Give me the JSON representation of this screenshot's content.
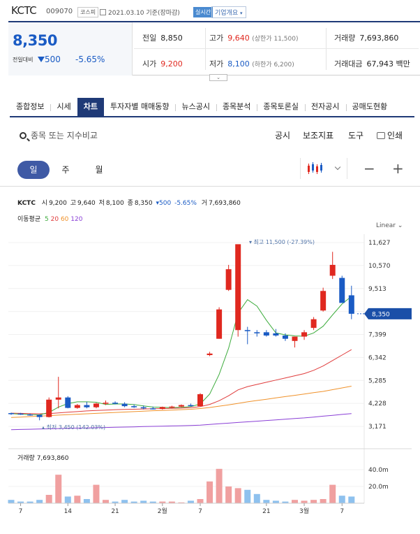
{
  "header": {
    "name": "KCTC",
    "code": "009070",
    "market": "코스피",
    "date": "2021.03.10 기준(장마감)",
    "realtime": "실시간",
    "corp_info": "기업개요"
  },
  "price": {
    "current": "8,350",
    "change_label": "전일대비",
    "change": "500",
    "pct": "-5.65%",
    "prev_label": "전일",
    "prev": "8,850",
    "high_label": "고가",
    "high": "9,640",
    "upper_limit": "(상한가 11,500)",
    "volume_label": "거래량",
    "volume": "7,693,860",
    "open_label": "시가",
    "open": "9,200",
    "low_label": "저가",
    "low": "8,100",
    "lower_limit": "(하한가 6,200)",
    "amount_label": "거래대금",
    "amount": "67,943",
    "amount_unit": "백만"
  },
  "tabs": [
    "종합정보",
    "시세",
    "차트",
    "투자자별 매매동향",
    "뉴스공시",
    "종목분석",
    "종목토론실",
    "전자공시",
    "공매도현황"
  ],
  "active_tab": "차트",
  "toolbar": {
    "search_placeholder": "종목 또는 지수비교",
    "disclosure": "공시",
    "indicator": "보조지표",
    "tools": "도구",
    "print": "인쇄"
  },
  "periods": [
    "일",
    "주",
    "월"
  ],
  "chart_info": {
    "name": "KCTC",
    "open_label": "시",
    "open": "9,200",
    "high_label": "고",
    "high": "9,640",
    "low_label": "저",
    "low": "8,100",
    "close_label": "종",
    "close": "8,350",
    "change": "500",
    "pct": "-5.65%",
    "vol_label": "거",
    "vol": "7,693,860",
    "ma_label": "이동평균",
    "ma_periods": [
      "5",
      "20",
      "60",
      "120"
    ],
    "scale": "Linear",
    "max_annotation": "최고 11,500 (-27.39%)",
    "min_annotation": "최저 3,450 (142.03%)",
    "current_tag": "8,350",
    "volume_title": "거래량 7,693,860"
  },
  "colors": {
    "up": "#e0281f",
    "down": "#1a5bc4",
    "ma5": "#3dac3d",
    "ma20": "#e03c3c",
    "ma60": "#f0922b",
    "ma120": "#8a3fd6",
    "nav": "#1f3a77"
  },
  "chart_data": {
    "type": "candlestick",
    "y_ticks": [
      11627,
      10570,
      9513,
      8456,
      7399,
      6342,
      5285,
      4228,
      3171
    ],
    "y_tick_labels": [
      "11,627",
      "10,570",
      "9,513",
      "",
      "7,399",
      "6,342",
      "5,285",
      "4,228",
      "3,171"
    ],
    "x_ticks": [
      {
        "i": 1,
        "label": "7"
      },
      {
        "i": 6,
        "label": "14"
      },
      {
        "i": 11,
        "label": "21"
      },
      {
        "i": 16,
        "label": "2월"
      },
      {
        "i": 20,
        "label": "7"
      },
      {
        "i": 27,
        "label": "21"
      },
      {
        "i": 31,
        "label": "3월"
      },
      {
        "i": 35,
        "label": "7"
      }
    ],
    "candles": [
      [
        3780,
        3800,
        3700,
        3760
      ],
      [
        3760,
        3790,
        3700,
        3720
      ],
      [
        3720,
        3760,
        3660,
        3700
      ],
      [
        3700,
        3720,
        3450,
        3600
      ],
      [
        3600,
        4500,
        3580,
        4400
      ],
      [
        4400,
        5450,
        4000,
        4500
      ],
      [
        4500,
        4560,
        4000,
        4020
      ],
      [
        4020,
        4200,
        3980,
        4150
      ],
      [
        4150,
        4300,
        4000,
        4050
      ],
      [
        4050,
        4250,
        4000,
        4220
      ],
      [
        4220,
        4360,
        4150,
        4260
      ],
      [
        4260,
        4320,
        4180,
        4210
      ],
      [
        4210,
        4280,
        4050,
        4100
      ],
      [
        4100,
        4180,
        4020,
        4050
      ],
      [
        4050,
        4130,
        3950,
        4000
      ],
      [
        4000,
        4080,
        3950,
        3970
      ],
      [
        3970,
        4080,
        3940,
        4060
      ],
      [
        4060,
        4120,
        4000,
        4080
      ],
      [
        4080,
        4180,
        4050,
        4150
      ],
      [
        4150,
        4220,
        4080,
        4100
      ],
      [
        4100,
        4700,
        4100,
        4650
      ],
      [
        6450,
        6600,
        6400,
        6520
      ],
      [
        7200,
        8650,
        7200,
        8550
      ],
      [
        9450,
        10600,
        9400,
        10400
      ],
      [
        7600,
        11500,
        7300,
        11550
      ],
      [
        7600,
        7750,
        6950,
        7550
      ],
      [
        7500,
        7600,
        7300,
        7450
      ],
      [
        7500,
        7600,
        7300,
        7350
      ],
      [
        7450,
        7650,
        7300,
        7350
      ],
      [
        7350,
        7450,
        7100,
        7200
      ],
      [
        7100,
        7300,
        6800,
        7300
      ],
      [
        7300,
        7600,
        7150,
        7500
      ],
      [
        7700,
        8200,
        7600,
        8100
      ],
      [
        8500,
        9550,
        8450,
        9400
      ],
      [
        10100,
        11200,
        9950,
        10600
      ],
      [
        10000,
        10100,
        8900,
        8850
      ],
      [
        9200,
        9640,
        8100,
        8350
      ]
    ],
    "ma5": [
      3760,
      3730,
      3710,
      3700,
      3810,
      4060,
      4220,
      4300,
      4300,
      4280,
      4180,
      4200,
      4200,
      4170,
      4110,
      4060,
      4050,
      4030,
      4050,
      4080,
      4200,
      4660,
      5560,
      6770,
      8380,
      9000,
      8700,
      8050,
      7470,
      7380,
      7330,
      7320,
      7470,
      7780,
      8300,
      8800,
      9150
    ],
    "ma20": [
      3780,
      3770,
      3760,
      3750,
      3760,
      3790,
      3820,
      3850,
      3880,
      3900,
      3920,
      3940,
      3950,
      3960,
      3970,
      3980,
      3990,
      4000,
      4010,
      4030,
      4080,
      4180,
      4350,
      4580,
      4850,
      5000,
      5100,
      5200,
      5300,
      5400,
      5500,
      5600,
      5750,
      5950,
      6200,
      6450,
      6700
    ],
    "ma60": [
      3580,
      3600,
      3620,
      3640,
      3660,
      3690,
      3710,
      3730,
      3750,
      3770,
      3790,
      3810,
      3830,
      3850,
      3870,
      3890,
      3900,
      3920,
      3940,
      3960,
      3990,
      4040,
      4100,
      4160,
      4230,
      4300,
      4360,
      4420,
      4480,
      4540,
      4600,
      4660,
      4720,
      4780,
      4860,
      4940,
      5020
    ],
    "ma120": [
      3020,
      3030,
      3040,
      3050,
      3060,
      3070,
      3080,
      3090,
      3100,
      3110,
      3120,
      3130,
      3140,
      3150,
      3160,
      3170,
      3180,
      3190,
      3200,
      3210,
      3230,
      3260,
      3290,
      3320,
      3350,
      3380,
      3410,
      3440,
      3470,
      3500,
      3530,
      3560,
      3600,
      3640,
      3680,
      3720,
      3760
    ],
    "volume_ticks": [
      {
        "v": 40,
        "label": "40.0m"
      },
      {
        "v": 20,
        "label": "20.0m"
      }
    ],
    "volume": [
      4,
      2,
      2,
      4,
      10,
      34,
      8,
      9,
      5,
      22,
      4,
      2,
      4,
      2,
      3,
      2,
      2,
      2,
      1,
      3,
      5,
      26,
      41,
      20,
      18,
      16,
      11,
      4,
      3,
      2,
      4,
      3,
      4,
      5,
      22,
      9,
      8
    ]
  }
}
